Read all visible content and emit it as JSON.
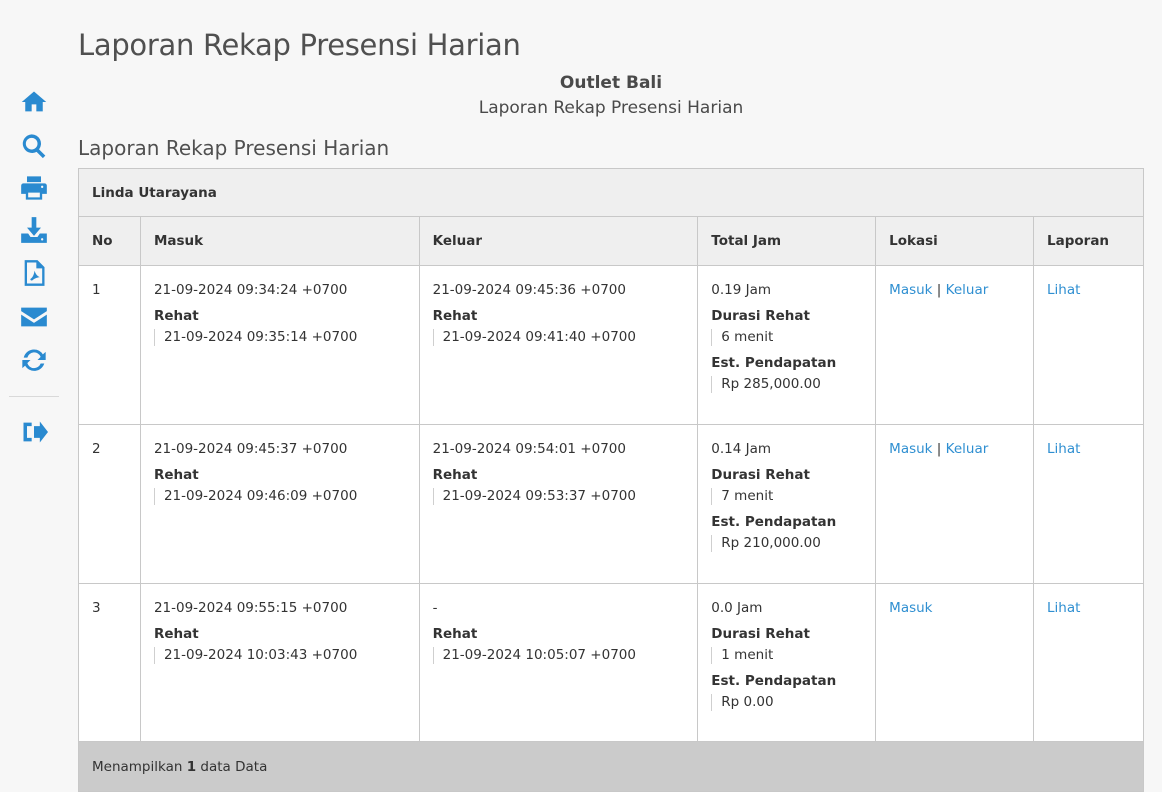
{
  "page": {
    "title": "Laporan Rekap Presensi Harian",
    "outlet": "Outlet Bali",
    "report_subtitle": "Laporan Rekap Presensi Harian",
    "section_title": "Laporan Rekap Presensi Harian"
  },
  "sidebar": {
    "icons": [
      "home-icon",
      "search-icon",
      "print-icon",
      "download-icon",
      "pdf-icon",
      "email-icon",
      "refresh-icon",
      "logout-icon"
    ],
    "accent_color": "#2a8ad0"
  },
  "table": {
    "employee": "Linda Utarayana",
    "headers": [
      "No",
      "Masuk",
      "Keluar",
      "Total Jam",
      "Lokasi",
      "Laporan"
    ],
    "break_label": "Rehat",
    "duration_label": "Durasi Rehat",
    "income_label": "Est. Pendapatan",
    "rows": [
      {
        "no": "1",
        "masuk": "21-09-2024 09:34:24 +0700",
        "masuk_rehat": "21-09-2024 09:35:14 +0700",
        "keluar": "21-09-2024 09:45:36 +0700",
        "keluar_rehat": "21-09-2024 09:41:40 +0700",
        "total_jam": "0.19 Jam",
        "durasi": "6 menit",
        "pendapatan": "Rp 285,000.00",
        "lokasi_masuk": "Masuk",
        "lokasi_sep": "|",
        "lokasi_keluar": "Keluar",
        "laporan": "Lihat"
      },
      {
        "no": "2",
        "masuk": "21-09-2024 09:45:37 +0700",
        "masuk_rehat": "21-09-2024 09:46:09 +0700",
        "keluar": "21-09-2024 09:54:01 +0700",
        "keluar_rehat": "21-09-2024 09:53:37 +0700",
        "total_jam": "0.14 Jam",
        "durasi": "7 menit",
        "pendapatan": "Rp 210,000.00",
        "lokasi_masuk": "Masuk",
        "lokasi_sep": "|",
        "lokasi_keluar": "Keluar",
        "laporan": "Lihat"
      },
      {
        "no": "3",
        "masuk": "21-09-2024 09:55:15 +0700",
        "masuk_rehat": "21-09-2024 10:03:43 +0700",
        "keluar": "-",
        "keluar_rehat": "21-09-2024 10:05:07 +0700",
        "total_jam": "0.0 Jam",
        "durasi": "1 menit",
        "pendapatan": "Rp 0.00",
        "lokasi_masuk": "Masuk",
        "laporan": "Lihat"
      }
    ],
    "footer": {
      "prefix": "Menampilkan",
      "count": "1",
      "suffix": "data Data"
    }
  }
}
